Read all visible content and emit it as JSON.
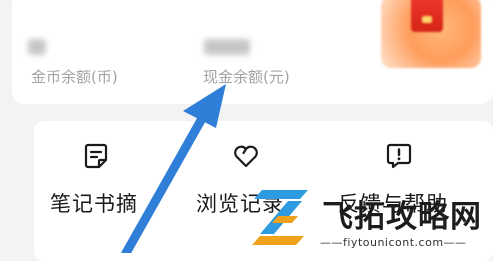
{
  "wallet": {
    "coin_balance_label": "金币余额(币)",
    "cash_balance_label": "现金余额(元)",
    "balances_obscured": true
  },
  "menu": {
    "items": [
      {
        "label": "笔记书摘",
        "icon": "note-icon"
      },
      {
        "label": "浏览记录",
        "icon": "heart-icon"
      },
      {
        "label": "反馈与帮助",
        "icon": "feedback-icon"
      }
    ]
  },
  "annotation": {
    "arrow_color": "#2f7fd9",
    "points_to": "cash-balance-label"
  },
  "watermark": {
    "brand_name": "飞拓攻略网",
    "url": "——fiytounicont.com——",
    "colors": [
      "#2e9be0",
      "#f0a21c"
    ]
  }
}
